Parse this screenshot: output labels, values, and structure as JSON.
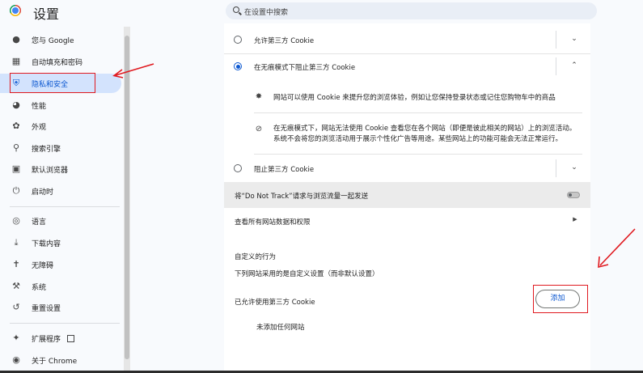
{
  "header": {
    "title": "设置",
    "search_placeholder": "在设置中搜索"
  },
  "sidebar": {
    "items": [
      {
        "label": "您与 Google",
        "icon": "person-icon"
      },
      {
        "label": "自动填充和密码",
        "icon": "clipboard-icon"
      },
      {
        "label": "隐私和安全",
        "icon": "shield-icon",
        "active": true
      },
      {
        "label": "性能",
        "icon": "speedometer-icon"
      },
      {
        "label": "外观",
        "icon": "palette-icon"
      },
      {
        "label": "搜索引擎",
        "icon": "search-icon"
      },
      {
        "label": "默认浏览器",
        "icon": "browser-icon"
      },
      {
        "label": "启动时",
        "icon": "power-icon"
      },
      {
        "label": "语言",
        "icon": "globe-icon"
      },
      {
        "label": "下载内容",
        "icon": "download-icon"
      },
      {
        "label": "无障碍",
        "icon": "accessibility-icon"
      },
      {
        "label": "系统",
        "icon": "wrench-icon"
      },
      {
        "label": "重置设置",
        "icon": "reset-icon"
      },
      {
        "label": "扩展程序",
        "icon": "puzzle-icon"
      },
      {
        "label": "关于 Chrome",
        "icon": "chrome-icon"
      }
    ]
  },
  "cookies": {
    "options": [
      {
        "label": "允许第三方 Cookie",
        "selected": false
      },
      {
        "label": "在无痕模式下阻止第三方 Cookie",
        "selected": true
      },
      {
        "label": "阻止第三方 Cookie",
        "selected": false
      }
    ],
    "detail_1": "网站可以使用 Cookie 来提升您的浏览体验，例如让您保持登录状态或记住您购物车中的商品",
    "detail_2_line1": "在无痕模式下，网站无法使用 Cookie 查看您在各个网站（即便是彼此相关的网站）上的浏览活动。",
    "detail_2_line2": "系统不会将您的浏览活动用于展示个性化广告等用途。某些网站上的功能可能会无法正常运行。",
    "dnt_label": "将“Do Not Track”请求与浏览流量一起发送",
    "dnt_enabled": false,
    "site_data_label": "查看所有网站数据和权限",
    "custom_heading": "自定义的行为",
    "custom_desc": "下列网站采用的是自定义设置（而非默认设置）",
    "allowed_label": "已允许使用第三方 Cookie",
    "add_label": "添加",
    "empty_label": "未添加任何网站"
  },
  "colors": {
    "accent": "#0b57d0",
    "active_bg": "#d3e3fd",
    "annotation_red": "#e0191f"
  }
}
